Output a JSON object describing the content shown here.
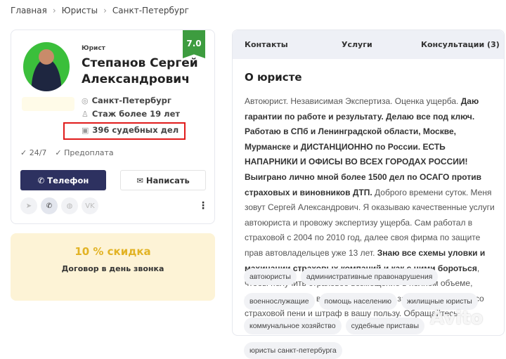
{
  "breadcrumb": [
    "Главная",
    "Юристы",
    "Санкт-Петербург"
  ],
  "profile": {
    "role": "Юрист",
    "name_line1": "Степанов Сергей",
    "name_line2": "Александрович",
    "rating": "7.0",
    "city": "Санкт-Петербург",
    "experience": "Стаж более 19 лет",
    "cases": "396 судебных дел",
    "features": [
      "24/7",
      "Предоплата"
    ],
    "phone_label": "Телефон",
    "write_label": "Написать",
    "social": [
      "telegram",
      "whatsapp",
      "web",
      "vk"
    ],
    "vk_label": "VK"
  },
  "promo": {
    "title": "10 % скидка",
    "subtitle": "Договор в день звонка"
  },
  "tabs": [
    "Контакты",
    "Услуги",
    "Консультации (3)"
  ],
  "about": {
    "title": "О юристе",
    "segments": [
      {
        "text": "Автоюрист. Независимая Экспертиза. Оценка ущерба. ",
        "bold": false
      },
      {
        "text": "Даю гарантии по работе и результату. Делаю все под ключ. Работаю в СПб и Ленинградской области, Москве, Мурманске и ДИСТАНЦИОННО по России.  ЕСТЬ НАПАРНИКИ И ОФИСЫ ВО ВСЕХ ГОРОДАХ РОССИИ! Выиграно лично мной более 1500 дел по ОСАГО против страховых и виновников ДТП.",
        "bold": true
      },
      {
        "text": " Доброго времени суток. Меня зовут Сергей Александрович. Я оказываю качественные услуги автоюриста и провожу экспертизу ущерба. Сам работал в страховой с 2004 по 2010 год, далее своя фирма по защите прав автовладельцев уже 13 лет. ",
        "bold": false
      },
      {
        "text": "Знаю все схемы уловки и махинации страховых компаний и как с ними бороться",
        "bold": true
      },
      {
        "text": ", чтобы получить страховое возмещение в полном объеме, взыскать ущерб с виновника за новые запчасти, получить со страховой пени и штраф в вашу пользу. Обращайтесь.",
        "bold": false
      }
    ]
  },
  "tags": [
    "автоюристы",
    "административные правонарушения",
    "военнослужащие",
    "помощь населению",
    "жилищные юристы",
    "коммунальное хозяйство",
    "судебные приставы",
    "юристы санкт-петербурга"
  ],
  "watermark": "Avito",
  "colors": {
    "primary": "#2d3160",
    "rating": "#3d9c3f",
    "promo_bg": "#fdf3d6",
    "promo_text": "#e2b325",
    "highlight": "#e01b1b"
  }
}
